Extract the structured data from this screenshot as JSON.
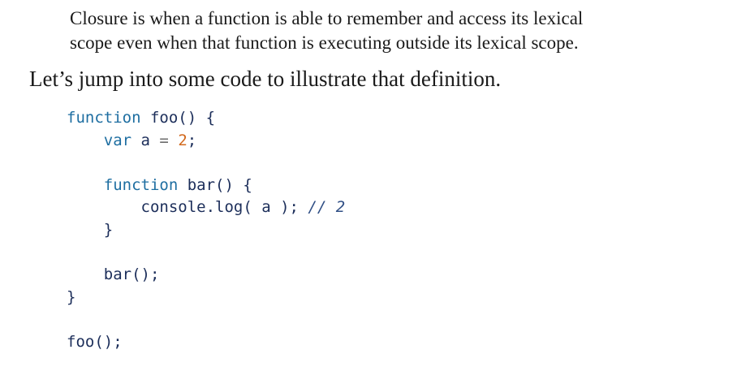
{
  "quote": {
    "line1": "Closure is when a function is able to remember and access its lexical",
    "line2": "scope even when that function is executing outside its lexical scope."
  },
  "paragraph": "Let’s jump into some code to illustrate that definition.",
  "code": {
    "l1": {
      "kw": "function",
      "rest": " foo() {"
    },
    "l2": {
      "indent": "    ",
      "kw": "var",
      "mid": " a ",
      "op": "=",
      "sp": " ",
      "num": "2",
      "end": ";"
    },
    "l3": "",
    "l4": {
      "indent": "    ",
      "kw": "function",
      "rest": " bar() {"
    },
    "l5": {
      "indent": "        ",
      "text": "console.log( a ); ",
      "comment": "// 2"
    },
    "l6": {
      "indent": "    ",
      "text": "}"
    },
    "l7": "",
    "l8": {
      "indent": "    ",
      "text": "bar();"
    },
    "l9": {
      "text": "}"
    },
    "l10": "",
    "l11": {
      "text": "foo();"
    }
  }
}
